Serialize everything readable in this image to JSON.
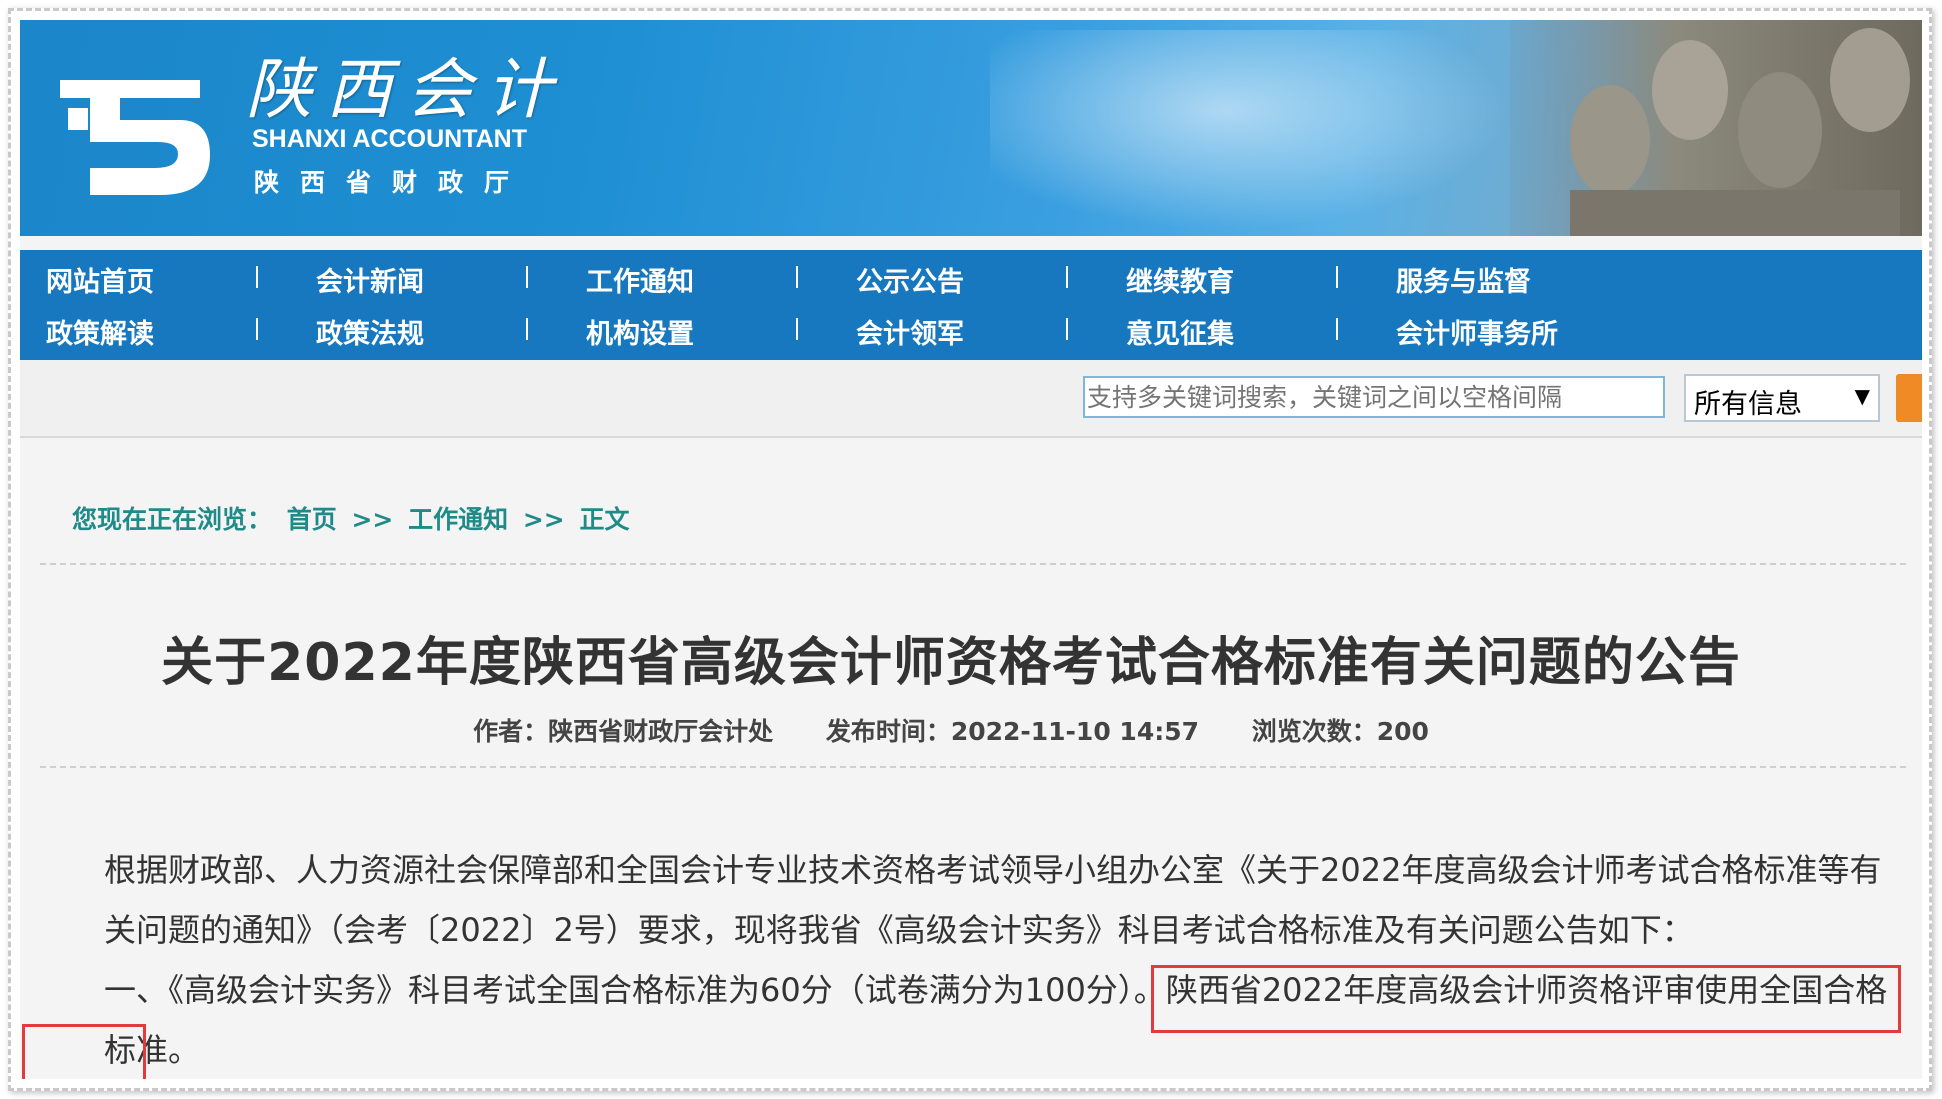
{
  "banner": {
    "title": "陕西会计",
    "subtitle_en": "SHANXI ACCOUNTANT",
    "org": "陕西省财政厅",
    "logo_icon": "shanxi-accountant-logo",
    "decor": "terracotta-warriors-photo"
  },
  "nav": {
    "row1": [
      "网站首页",
      "会计新闻",
      "工作通知",
      "公示公告",
      "继续教育",
      "服务与监督"
    ],
    "row2": [
      "政策解读",
      "政策法规",
      "机构设置",
      "会计领军",
      "意见征集",
      "会计师事务所"
    ]
  },
  "search": {
    "placeholder": "支持多关键词搜索，关键词之间以空格间隔",
    "select_value": "所有信息",
    "select_arrow": "▼",
    "button_color": "#f08a24"
  },
  "breadcrumb": {
    "label": "您现在正在浏览：",
    "items": [
      "首页",
      "工作通知",
      "正文"
    ],
    "separator": ">>"
  },
  "article": {
    "title": "关于2022年度陕西省高级会计师资格考试合格标准有关问题的公告",
    "author": "作者：陕西省财政厅会计处",
    "published": "发布时间：2022-11-10 14:57",
    "views": "浏览次数：200",
    "para1": "根据财政部、人力资源社会保障部和全国会计专业技术资格考试领导小组办公室《关于2022年度高级会计师考试合格标准等有关问题的通知》（会考〔2022〕2号）要求，现将我省《高级会计实务》科目考试合格标准及有关问题公告如下：",
    "para2_a": "一、《高级会计实务》科目考试全国合格标准为60分（试卷满分为100分）。",
    "para2_b": "陕西省2022年度高级会计师资格评审使用全国合格",
    "para2_c": "标准。"
  },
  "colors": {
    "nav_bg": "#1778bf",
    "breadcrumb": "#1f8a88",
    "highlight_box": "#e23b3b"
  }
}
